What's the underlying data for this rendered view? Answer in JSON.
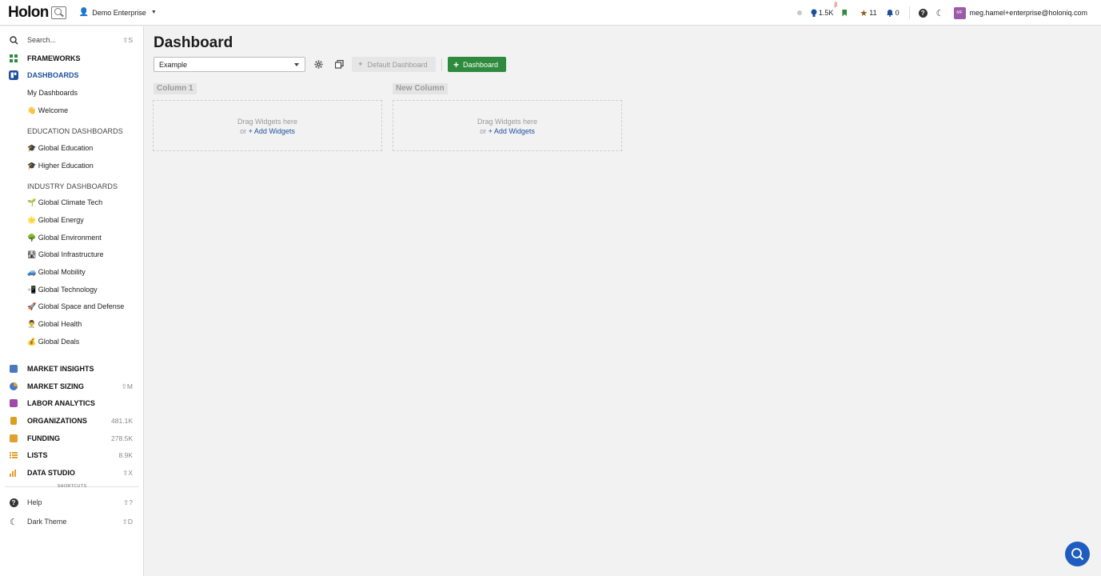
{
  "header": {
    "logo_text": "Holon",
    "org_name": "Demo Enterprise",
    "insights_count": "1.5K",
    "beta_mark": "β",
    "stars_count": "11",
    "alerts_count": "0",
    "avatar_initials": "MF",
    "user_email": "meg.hamel+enterprise@holoniq.com"
  },
  "sidebar": {
    "search": {
      "label": "Search...",
      "shortcut": "S"
    },
    "frameworks": "FRAMEWORKS",
    "dashboards": "DASHBOARDS",
    "my_dashboards": "My Dashboards",
    "welcome": {
      "emoji": "👋",
      "label": "Welcome"
    },
    "education_heading": "EDUCATION DASHBOARDS",
    "education_items": [
      {
        "emoji": "🎓",
        "label": "Global Education"
      },
      {
        "emoji": "🎓",
        "label": "Higher Education"
      }
    ],
    "industry_heading": "INDUSTRY DASHBOARDS",
    "industry_items": [
      {
        "emoji": "🌱",
        "label": "Global Climate Tech"
      },
      {
        "emoji": "🌟",
        "label": "Global Energy"
      },
      {
        "emoji": "🌳",
        "label": "Global Environment"
      },
      {
        "emoji": "🛣",
        "label": "Global Infrastructure"
      },
      {
        "emoji": "🚙",
        "label": "Global Mobility"
      },
      {
        "emoji": "📲",
        "label": "Global Technology"
      },
      {
        "emoji": "🚀",
        "label": "Global Space and Defense"
      },
      {
        "emoji": "👨‍⚕️",
        "label": "Global Health"
      },
      {
        "emoji": "💰",
        "label": "Global Deals"
      }
    ],
    "sections": [
      {
        "label": "MARKET INSIGHTS",
        "right": ""
      },
      {
        "label": "MARKET SIZING",
        "right": "M"
      },
      {
        "label": "LABOR ANALYTICS",
        "right": ""
      },
      {
        "label": "ORGANIZATIONS",
        "right": "481.1K"
      },
      {
        "label": "FUNDING",
        "right": "278.5K"
      },
      {
        "label": "LISTS",
        "right": "8.9K"
      },
      {
        "label": "DATA STUDIO",
        "right": "X"
      }
    ],
    "shortcuts_label": "SHORTCUTS",
    "help": {
      "label": "Help",
      "shortcut": "?"
    },
    "dark_theme": {
      "label": "Dark Theme",
      "shortcut": "D"
    }
  },
  "main": {
    "title": "Dashboard",
    "dashboard_select": "Example",
    "default_dashboard_label": "Default Dashboard",
    "add_dashboard_label": "Dashboard",
    "columns": [
      {
        "name": "Column 1",
        "drag_text": "Drag Widgets here",
        "or_text": "or",
        "add_text": "+ Add Widgets"
      },
      {
        "name": "New Column",
        "drag_text": "Drag Widgets here",
        "or_text": "or",
        "add_text": "+ Add Widgets"
      }
    ]
  },
  "colors": {
    "accent_blue": "#1e4f9c",
    "primary_green": "#2e8b3d",
    "chat_blue": "#1e5dbf"
  },
  "icons": {
    "shift_key": "⇧"
  }
}
